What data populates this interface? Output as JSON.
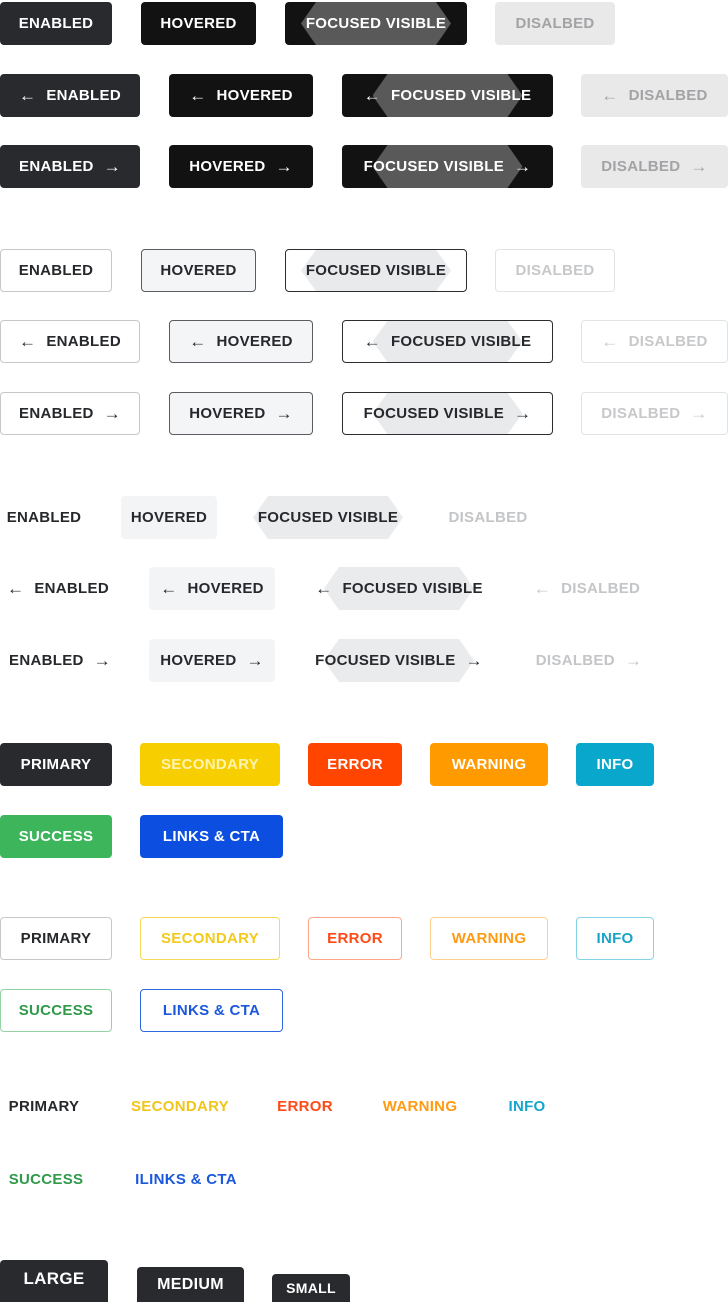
{
  "state_labels": {
    "enabled": "ENABLED",
    "hovered": "HOVERED",
    "focused": "FOCUSED VISIBLE",
    "disabled": "DISALBED"
  },
  "arrow_left": "←",
  "arrow_right": "→",
  "color_labels": {
    "primary": "PRIMARY",
    "secondary": "SECONDARY",
    "error": "ERROR",
    "warning": "WARNING",
    "info": "INFO",
    "success": "SUCCESS",
    "links": "LINKS & CTA",
    "links_text_variant": "ILINKS & CTA"
  },
  "size_labels": {
    "large": "LARGE",
    "medium": "MEDIUM",
    "small": "SMALL"
  },
  "colors": {
    "primary": "#282a2e",
    "secondary": "#f7cf00",
    "error": "#ff4500",
    "warning": "#ff9a00",
    "info": "#0aa7cc",
    "success": "#3cb55b",
    "links": "#0c4fe0"
  },
  "icons": {
    "left": "arrow-left-icon",
    "right": "arrow-right-icon"
  }
}
